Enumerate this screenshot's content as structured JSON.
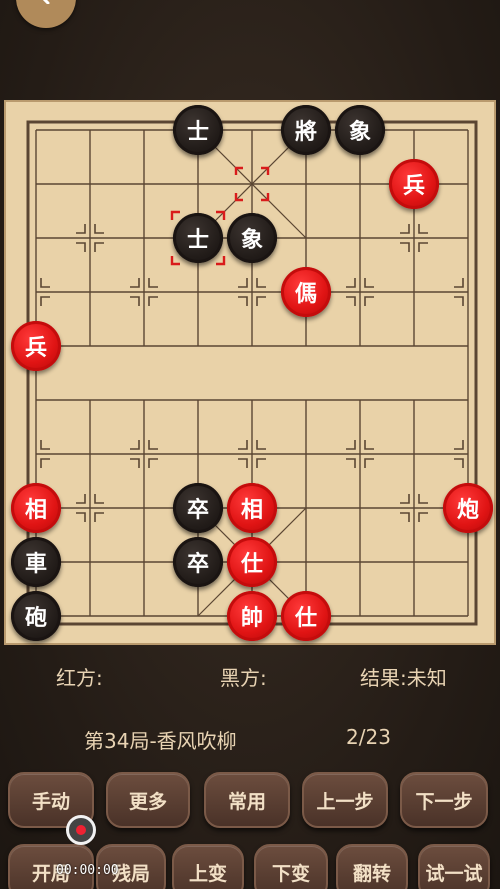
{
  "board": {
    "pieces": [
      {
        "name": "black-advisor-top",
        "label": "士",
        "color": "black",
        "col": 3,
        "row": 0
      },
      {
        "name": "black-general",
        "label": "將",
        "color": "black",
        "col": 5,
        "row": 0
      },
      {
        "name": "black-elephant-top",
        "label": "象",
        "color": "black",
        "col": 6,
        "row": 0
      },
      {
        "name": "red-soldier-top-right",
        "label": "兵",
        "color": "red",
        "col": 7,
        "row": 1
      },
      {
        "name": "black-advisor-mid",
        "label": "士",
        "color": "black",
        "col": 3,
        "row": 2
      },
      {
        "name": "black-elephant-mid",
        "label": "象",
        "color": "black",
        "col": 4,
        "row": 2
      },
      {
        "name": "red-horse",
        "label": "傌",
        "color": "red",
        "col": 5,
        "row": 3
      },
      {
        "name": "red-soldier-left",
        "label": "兵",
        "color": "red",
        "col": 0,
        "row": 4
      },
      {
        "name": "red-elephant-left",
        "label": "相",
        "color": "red",
        "col": 0,
        "row": 7
      },
      {
        "name": "black-pawn-upper",
        "label": "卒",
        "color": "black",
        "col": 3,
        "row": 7
      },
      {
        "name": "red-elephant-center",
        "label": "相",
        "color": "red",
        "col": 4,
        "row": 7
      },
      {
        "name": "red-cannon",
        "label": "炮",
        "color": "red",
        "col": 8,
        "row": 7
      },
      {
        "name": "black-chariot",
        "label": "車",
        "color": "black",
        "col": 0,
        "row": 8
      },
      {
        "name": "black-pawn-lower",
        "label": "卒",
        "color": "black",
        "col": 3,
        "row": 8
      },
      {
        "name": "red-advisor-upper",
        "label": "仕",
        "color": "red",
        "col": 4,
        "row": 8
      },
      {
        "name": "black-cannon",
        "label": "砲",
        "color": "black",
        "col": 0,
        "row": 9
      },
      {
        "name": "red-general",
        "label": "帥",
        "color": "red",
        "col": 4,
        "row": 9
      },
      {
        "name": "red-advisor-lower",
        "label": "仕",
        "color": "red",
        "col": 5,
        "row": 9
      }
    ],
    "selected": {
      "col": 3,
      "row": 2
    },
    "last_move_from": {
      "col": 4,
      "row": 1
    },
    "colors": {
      "red": "#e01414",
      "black": "#221c19",
      "board": "#e9d2a8",
      "line": "#5b4633",
      "highlight": "#d91b1b"
    }
  },
  "status": {
    "red_label": "红方:",
    "black_label": "黑方:",
    "result_label": "结果:未知"
  },
  "game": {
    "title": "第34局-香风吹柳",
    "progress": "2/23"
  },
  "buttons": {
    "manual": "手动",
    "more": "更多",
    "common": "常用",
    "prev": "上一步",
    "next": "下一步",
    "opening": "开局",
    "endgame": "残局",
    "prev_variation": "上变",
    "next_variation": "下变",
    "flip": "翻转",
    "try": "试一试"
  },
  "recording": {
    "time": "00:00:00",
    "icon": "record-icon"
  }
}
